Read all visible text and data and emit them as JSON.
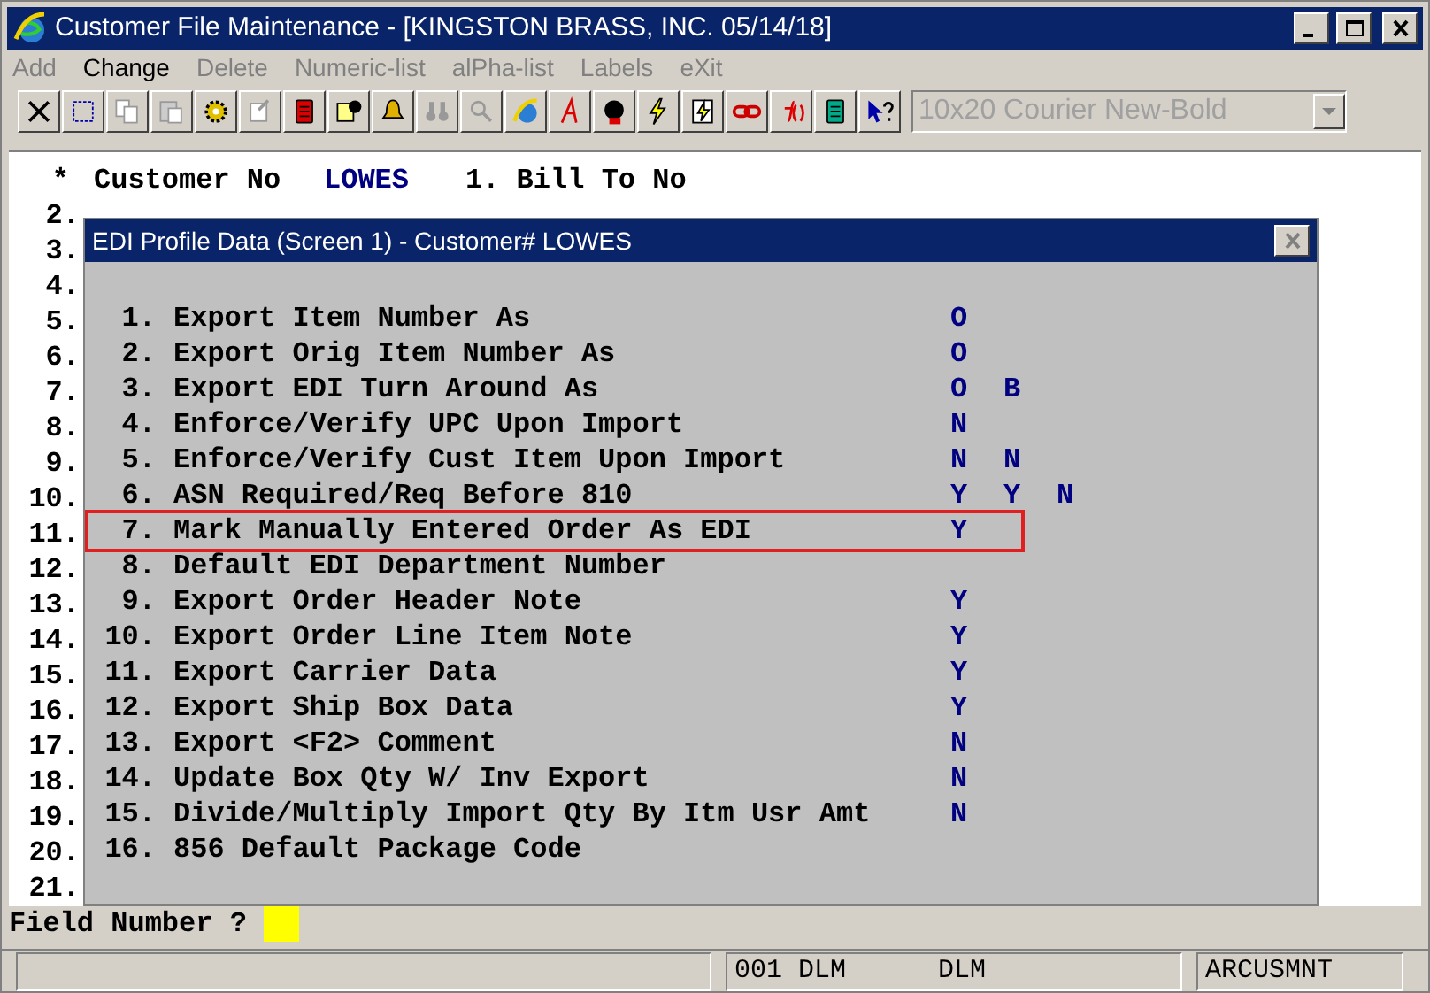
{
  "window": {
    "title": "Customer File Maintenance - [KINGSTON BRASS, INC. 05/14/18]"
  },
  "menu": [
    {
      "label": "Add",
      "disabled": true
    },
    {
      "label": "Change",
      "disabled": false
    },
    {
      "label": "Delete",
      "disabled": true
    },
    {
      "label": "Numeric-list",
      "disabled": true
    },
    {
      "label": "alPha-list",
      "disabled": true
    },
    {
      "label": "Labels",
      "disabled": true
    },
    {
      "label": "eXit",
      "disabled": true
    }
  ],
  "font_selector": {
    "value": "10x20 Courier New-Bold",
    "disabled": true
  },
  "screen": {
    "rows": [
      {
        "number": "*",
        "label": "Customer No",
        "value": "LOWES",
        "extra": "1. Bill To No"
      },
      {
        "number": "2."
      },
      {
        "number": "3."
      },
      {
        "number": "4."
      },
      {
        "number": "5."
      },
      {
        "number": "6."
      },
      {
        "number": "7."
      },
      {
        "number": "8."
      },
      {
        "number": "9."
      },
      {
        "number": "10."
      },
      {
        "number": "11."
      },
      {
        "number": "12."
      },
      {
        "number": "13."
      },
      {
        "number": "14."
      },
      {
        "number": "15."
      },
      {
        "number": "16."
      },
      {
        "number": "17."
      },
      {
        "number": "18."
      },
      {
        "number": "19."
      },
      {
        "number": "20."
      },
      {
        "number": "21."
      }
    ]
  },
  "dialog": {
    "title": "EDI Profile Data (Screen 1) - Customer# LOWES",
    "items": [
      {
        "number": "1.",
        "label": "Export Item Number As",
        "values": [
          "O"
        ],
        "highlighted": false
      },
      {
        "number": "2.",
        "label": "Export Orig Item Number As",
        "values": [
          "O"
        ],
        "highlighted": false
      },
      {
        "number": "3.",
        "label": "Export EDI Turn Around As",
        "values": [
          "O",
          "B"
        ],
        "highlighted": false
      },
      {
        "number": "4.",
        "label": "Enforce/Verify UPC Upon Import",
        "values": [
          "N"
        ],
        "highlighted": false
      },
      {
        "number": "5.",
        "label": "Enforce/Verify Cust Item Upon Import",
        "values": [
          "N",
          "N"
        ],
        "highlighted": false
      },
      {
        "number": "6.",
        "label": "ASN Required/Req Before 810",
        "values": [
          "Y",
          "Y",
          "N"
        ],
        "highlighted": false
      },
      {
        "number": "7.",
        "label": "Mark Manually Entered Order As EDI",
        "values": [
          "Y"
        ],
        "highlighted": true
      },
      {
        "number": "8.",
        "label": "Default EDI Department Number",
        "highlighted": false
      },
      {
        "number": "9.",
        "label": "Export Order Header Note",
        "values": [
          "Y"
        ],
        "highlighted": false
      },
      {
        "number": "10.",
        "label": "Export Order Line Item Note",
        "values": [
          "Y"
        ],
        "highlighted": false
      },
      {
        "number": "11.",
        "label": "Export Carrier Data",
        "values": [
          "Y"
        ],
        "highlighted": false
      },
      {
        "number": "12.",
        "label": "Export Ship Box Data",
        "values": [
          "Y"
        ],
        "highlighted": false
      },
      {
        "number": "13.",
        "label": "Export <F2> Comment",
        "values": [
          "N"
        ],
        "highlighted": false
      },
      {
        "number": "14.",
        "label": "Update Box Qty W/ Inv Export",
        "values": [
          "N"
        ],
        "highlighted": false
      },
      {
        "number": "15.",
        "label": "Divide/Multiply Import Qty By Itm Usr Amt",
        "values": [
          "N"
        ],
        "highlighted": false
      },
      {
        "number": "16.",
        "label": "856 Default Package Code",
        "highlighted": false
      }
    ]
  },
  "prompt": {
    "label": "Field Number ?"
  },
  "status_bar": [
    {
      "text": "001 DLM",
      "text_2": "DLM"
    },
    {
      "text": "ARCUSMNT"
    }
  ]
}
